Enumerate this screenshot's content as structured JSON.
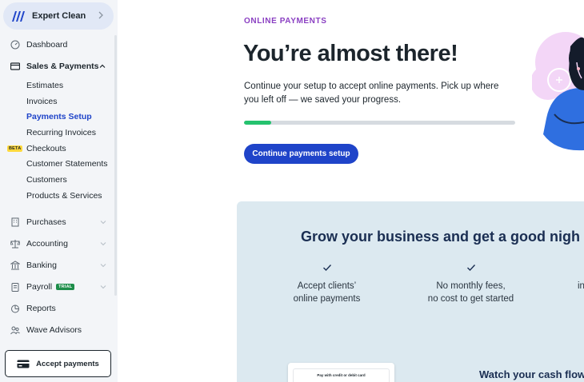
{
  "sidebar": {
    "business_name": "Expert Clean",
    "items": [
      {
        "label": "Dashboard",
        "icon": "gauge-icon"
      },
      {
        "label": "Sales & Payments",
        "icon": "receipt-icon"
      },
      {
        "label": "Purchases",
        "icon": "building-icon"
      },
      {
        "label": "Accounting",
        "icon": "scale-icon"
      },
      {
        "label": "Banking",
        "icon": "bank-icon"
      },
      {
        "label": "Payroll",
        "icon": "clipboard-icon",
        "badge": "TRIAL"
      },
      {
        "label": "Reports",
        "icon": "pie-chart-icon"
      },
      {
        "label": "Wave Advisors",
        "icon": "people-icon"
      }
    ],
    "sub_items": [
      {
        "label": "Estimates"
      },
      {
        "label": "Invoices"
      },
      {
        "label": "Payments Setup",
        "active": true
      },
      {
        "label": "Recurring Invoices"
      },
      {
        "label": "Checkouts",
        "badge": "BETA"
      },
      {
        "label": "Customer Statements"
      },
      {
        "label": "Customers"
      },
      {
        "label": "Products & Services"
      }
    ],
    "accept_payments_label": "Accept payments"
  },
  "main": {
    "eyebrow": "ONLINE PAYMENTS",
    "headline": "You’re almost there!",
    "description": "Continue your setup to accept online payments. Pick up where you left off — we saved your progress.",
    "progress_fraction": 0.1,
    "cta_label": "Continue payments setup"
  },
  "panel": {
    "title": "Grow your business and get a good nigh",
    "features": [
      {
        "line1": "Accept clients’",
        "line2": "online payments"
      },
      {
        "line1": "No monthly fees,",
        "line2": "no cost to get started"
      },
      {
        "line1": "",
        "line2": "in"
      }
    ],
    "card_text": "Pay with credit or debit card",
    "cash_heading": "Watch your cash flow"
  },
  "colors": {
    "brand_blue": "#1f44c9",
    "eyebrow_purple": "#8a3fc2",
    "progress_green": "#25c26e",
    "panel_bg": "#dce9f0",
    "sidebar_bg": "#f3f5f8"
  }
}
